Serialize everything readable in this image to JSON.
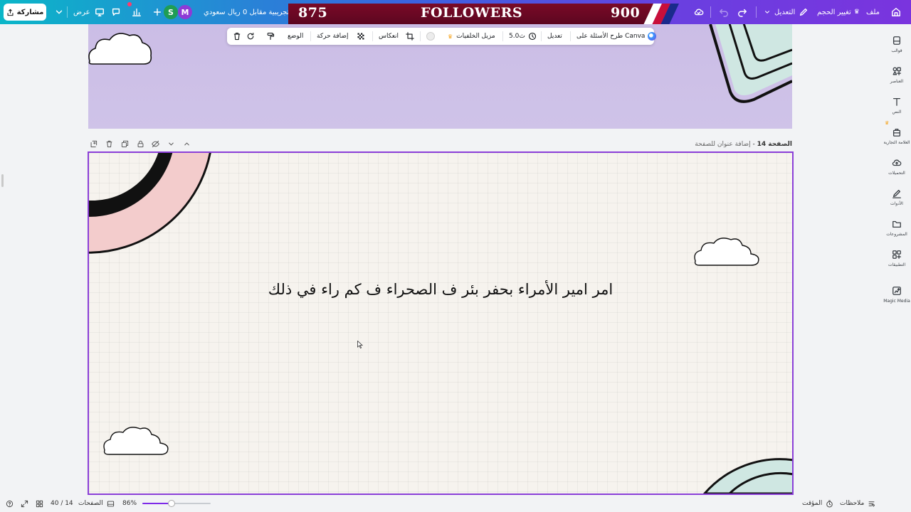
{
  "topbar": {
    "file_label": "ملف",
    "resize_label": "تغيير الحجم",
    "edit_label": "التعديل",
    "trial_text": "التجريبية مقابل 0 ريال سعودي",
    "present_label": "عرض",
    "share_label": "مشاركة",
    "avatars": [
      {
        "letter": "M",
        "color": "#8e3bd6"
      },
      {
        "letter": "S",
        "color": "#1f9d55"
      }
    ]
  },
  "banner": {
    "left_number": "875",
    "title": "FOLLOWERS",
    "right_number": "900",
    "stripe_colors": [
      "#ffffff",
      "#c80f3a",
      "#1a2a8c"
    ]
  },
  "context_toolbar": {
    "ask_canva": "طرح الأسئلة على Canva",
    "edit": "تعديل",
    "duration": "5.0ث",
    "bg_remover": "مزيل الخلفيات",
    "flip": "انعكاس",
    "animate": "إضافة حركة",
    "position": "الوضع"
  },
  "page_header": {
    "page_label": "الصفحة 14",
    "add_title": "إضافة عنوان للصفحة"
  },
  "canvas": {
    "main_text": "امر امير الأمراء بحفر بئر ف الصحراء ف كم راء في ذلك",
    "page_bg": "#f6f3ee",
    "top_page_bg": "#cbbde6",
    "selection_color": "#8b3fd8"
  },
  "sidebar": {
    "items": [
      {
        "label": "قوالب",
        "icon": "templates-icon"
      },
      {
        "label": "العناصر",
        "icon": "elements-icon"
      },
      {
        "label": "النص",
        "icon": "text-icon"
      },
      {
        "label": "العلامة التجارية",
        "icon": "brand-icon"
      },
      {
        "label": "التحميلات",
        "icon": "uploads-icon"
      },
      {
        "label": "الأدوات",
        "icon": "tools-icon"
      },
      {
        "label": "المشروعات",
        "icon": "projects-icon"
      },
      {
        "label": "التطبيقات",
        "icon": "apps-icon"
      },
      {
        "label": "Magic Media",
        "icon": "magic-media-icon"
      }
    ]
  },
  "bottombar": {
    "notes": "ملاحظات",
    "timer": "المؤقت",
    "zoom": "86%",
    "zoom_fraction": 0.43,
    "pages_label": "الصفحات",
    "page_count": "40 / 14"
  }
}
